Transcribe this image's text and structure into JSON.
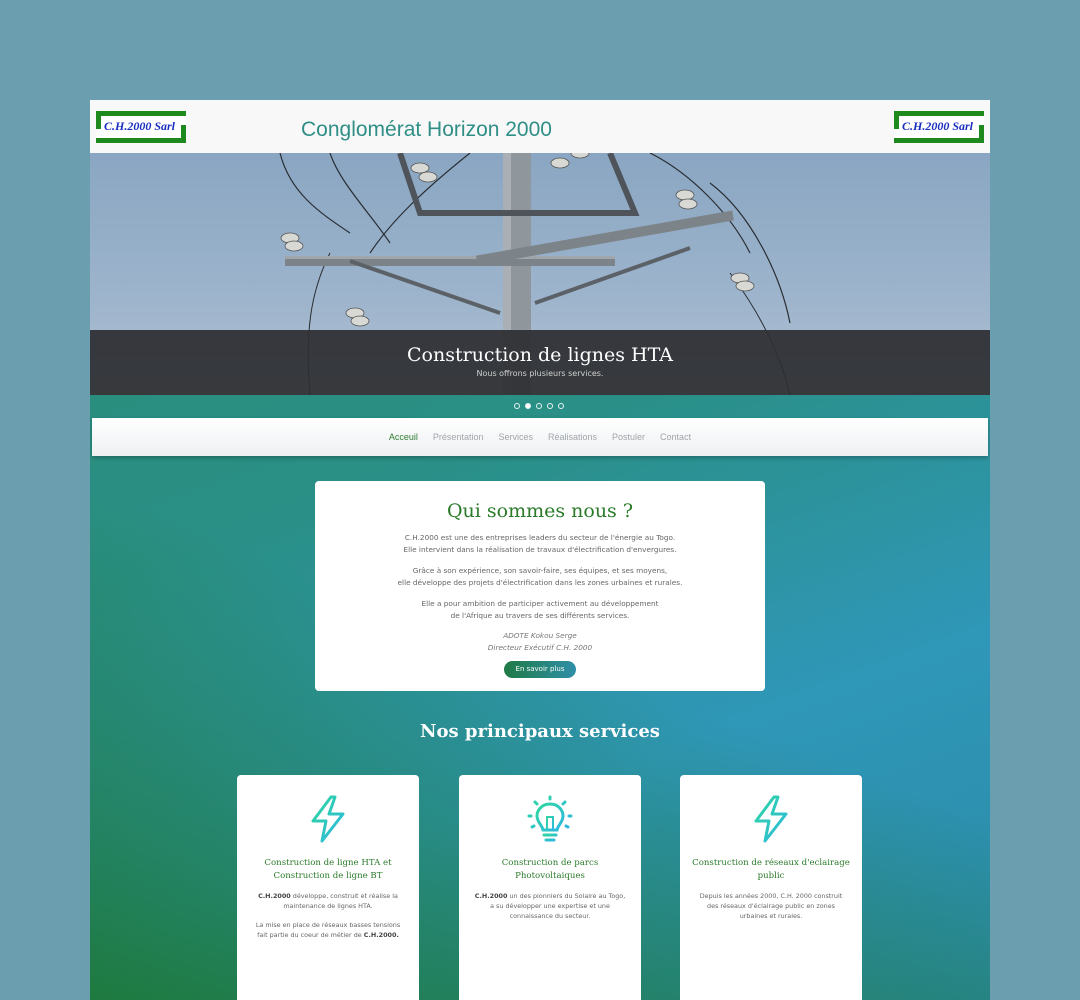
{
  "header": {
    "logo_text": "C.H.2000 Sarl",
    "title": "Conglomérat Horizon 2000"
  },
  "slider": {
    "caption_title": "Construction de lignes HTA",
    "caption_subtitle": "Nous offrons plusieurs services.",
    "slide_count": 5,
    "active_slide": 2
  },
  "nav": {
    "items": [
      {
        "label": "Acceuil",
        "active": true
      },
      {
        "label": "Présentation",
        "active": false
      },
      {
        "label": "Services",
        "active": false
      },
      {
        "label": "Réalisations",
        "active": false
      },
      {
        "label": "Postuler",
        "active": false
      },
      {
        "label": "Contact",
        "active": false
      }
    ]
  },
  "about": {
    "title": "Qui sommes nous ?",
    "para1": "C.H.2000 est une des entreprises leaders du secteur de l'énergie au Togo.\nElle intervient dans la réalisation de travaux d'électrification d'envergures.",
    "para2": "Grâce à son expérience, son savoir-faire, ses équipes, et ses moyens,\nelle développe des projets d'électrification dans les zones urbaines et rurales.",
    "para3": "Elle a pour ambition de participer activement au développement\nde l'Afrique au travers de ses différents services.",
    "signature": "ADOTE Kokou Serge\nDirecteur Exécutif C.H. 2000",
    "button_label": "En savoir plus"
  },
  "services": {
    "title": "Nos principaux services",
    "cards": [
      {
        "icon": "lightning-icon",
        "title": "Construction de ligne HTA et Construction de ligne BT",
        "brand": "C.H.2000",
        "text1": " développe, construit et réalise la maintenance de lignes HTA.",
        "text2": "La mise en place de réseaux basses tensions fait partie du coeur de métier de ",
        "text2_brand": "C.H.2000."
      },
      {
        "icon": "lightbulb-icon",
        "title": "Construction de parcs Photovoltaiques",
        "brand": "C.H.2000",
        "text1": " un des pionniers du Solaire au Togo, a su développer une expertise et une connaissance du secteur."
      },
      {
        "icon": "lightning-icon",
        "title": "Construction de réseaux d'eclairage public",
        "text1": "Depuis les années 2000, C.H. 2000 construit des réseaux d'éclairage public en zones urbaines et rurales."
      }
    ]
  },
  "colors": {
    "accent_green": "#2a7a2a",
    "teal": "#2f97b8",
    "icon_gradient_start": "#2fd6a0",
    "icon_gradient_end": "#2fb8e0"
  }
}
